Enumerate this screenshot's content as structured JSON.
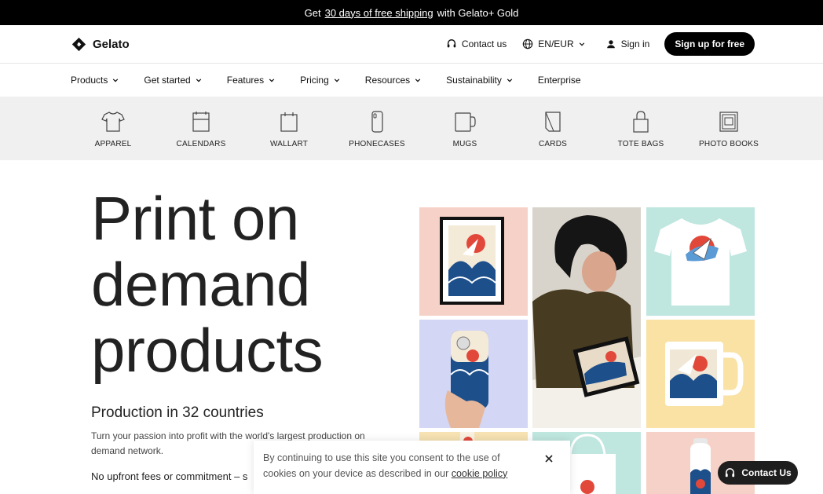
{
  "promo": {
    "prefix": "Get",
    "link": "30 days of free shipping",
    "suffix": "with Gelato+ Gold"
  },
  "header": {
    "logo_text": "Gelato",
    "contact_label": "Contact us",
    "language_label": "EN/EUR",
    "signin_label": "Sign in",
    "signup_label": "Sign up for free"
  },
  "nav": [
    {
      "label": "Products",
      "dropdown": true
    },
    {
      "label": "Get started",
      "dropdown": true
    },
    {
      "label": "Features",
      "dropdown": true
    },
    {
      "label": "Pricing",
      "dropdown": true
    },
    {
      "label": "Resources",
      "dropdown": true
    },
    {
      "label": "Sustainability",
      "dropdown": true
    },
    {
      "label": "Enterprise",
      "dropdown": false
    }
  ],
  "categories": [
    {
      "label": "APPAREL",
      "icon": "tshirt-icon"
    },
    {
      "label": "CALENDARS",
      "icon": "calendar-icon"
    },
    {
      "label": "WALLART",
      "icon": "wall-art-icon"
    },
    {
      "label": "PHONECASES",
      "icon": "phone-case-icon"
    },
    {
      "label": "MUGS",
      "icon": "mug-icon"
    },
    {
      "label": "CARDS",
      "icon": "card-icon"
    },
    {
      "label": "TOTE BAGS",
      "icon": "tote-bag-icon"
    },
    {
      "label": "PHOTO BOOKS",
      "icon": "photo-book-icon"
    }
  ],
  "hero": {
    "title_line1": "Print on",
    "title_line2": "demand",
    "title_line3": "products",
    "subtitle": "Production in 32 countries",
    "description": "Turn your passion into profit with the world's largest production on demand network.",
    "fees": "No upfront fees or commitment – s"
  },
  "cookie": {
    "text": "By continuing to use this site you consent to the use of cookies on your device as described in our",
    "link": "cookie policy"
  },
  "contact_pill": {
    "label": "Contact Us"
  },
  "colors": {
    "accent": "#000000",
    "promo_bg": "#000000",
    "category_bg": "#f0f0f0",
    "artwork_red": "#e2483a",
    "artwork_blue": "#1d4f8b"
  }
}
